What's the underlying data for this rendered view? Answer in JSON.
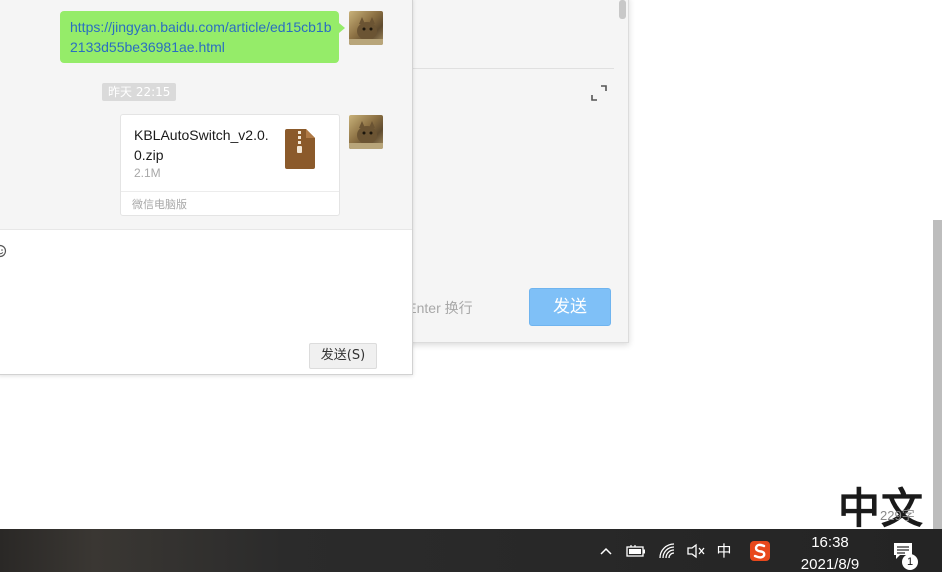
{
  "background_window": {
    "hint_text": "l+Enter 换行",
    "send_label": "发送"
  },
  "chat": {
    "messages": [
      {
        "type": "link",
        "text": "https://jingyan.baidu.com/article/ed15cb1b2133d55be36981ae.html"
      }
    ],
    "timestamp": "昨天 22:15",
    "file": {
      "name": "KBLAutoSwitch_v2.0.0.zip",
      "size": "2.1M",
      "source": "微信电脑版",
      "icon": "zip-file-icon"
    },
    "send_button_label": "发送(S)"
  },
  "ime_overlay": {
    "big_text": "中文",
    "small_text": "229字"
  },
  "taskbar": {
    "ime_indicator": "中",
    "time": "16:38",
    "date": "2021/8/9",
    "notification_count": "1"
  },
  "colors": {
    "bubble_green": "#95ec69",
    "link_blue": "#2a6ec1",
    "send_blue": "#7fc0f7",
    "taskbar": "#242424"
  }
}
